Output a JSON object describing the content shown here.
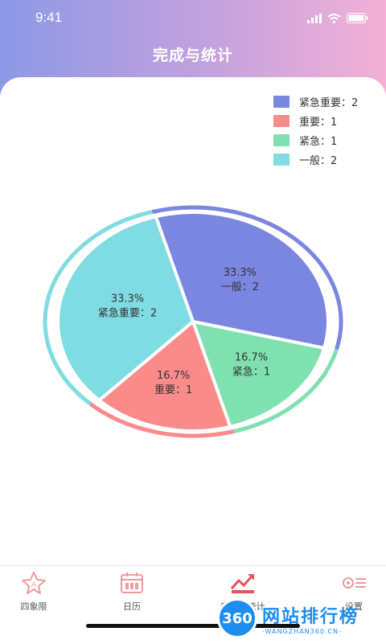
{
  "status_bar": {
    "time": "9:41"
  },
  "header": {
    "title": "完成与统计"
  },
  "legend": [
    {
      "label": "紧急重要：2",
      "color": "#7a86df"
    },
    {
      "label": "重要：1",
      "color": "#fb8a8a"
    },
    {
      "label": "紧急：1",
      "color": "#7fe0b0"
    },
    {
      "label": "一般：2",
      "color": "#7fdce2"
    }
  ],
  "chart_data": {
    "type": "pie",
    "categories": [
      "一般",
      "紧急",
      "重要",
      "紧急重要"
    ],
    "values": [
      2,
      1,
      1,
      2
    ],
    "colors": [
      "#7a86df",
      "#7fe0b0",
      "#fb8a8a",
      "#7fdce2"
    ],
    "percent_labels": [
      "33.3%",
      "16.7%",
      "16.7%",
      "33.3%"
    ],
    "name_labels": [
      "一般：2",
      "紧急：1",
      "重要：1",
      "紧急重要：2"
    ]
  },
  "tabs": [
    {
      "label": "四象限",
      "icon": "star-icon"
    },
    {
      "label": "日历",
      "icon": "calendar-icon"
    },
    {
      "label": "完成与统计",
      "icon": "trend-chart-icon",
      "active": true
    },
    {
      "label": "设置",
      "icon": "gear-icon"
    }
  ],
  "watermark": {
    "badge": "360",
    "main": "网站排行榜",
    "sub": "-WANGZHAN360.CN-"
  }
}
